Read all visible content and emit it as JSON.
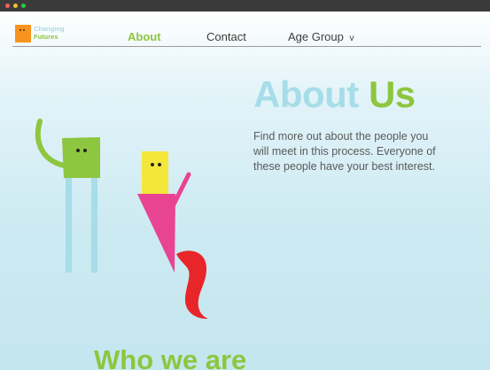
{
  "logo": {
    "line1": "Changing",
    "line2": "Futures"
  },
  "nav": {
    "about": "About",
    "contact": "Contact",
    "age_group": "Age Group",
    "age_group_chevron": "v"
  },
  "hero": {
    "title_word1": "About",
    "title_word2": "Us",
    "intro": "Find more out about the people you will meet in this process. Everyone of these people have your best interest."
  },
  "section": {
    "title": "Who we are"
  },
  "colors": {
    "green": "#8dc63f",
    "light_blue": "#a6dde8",
    "orange": "#f7931e",
    "pink": "#e94393",
    "yellow": "#f4e73a",
    "red": "#e8262a"
  },
  "window_controls": {
    "close_color": "#ff5f57",
    "minimize_color": "#febc2e",
    "maximize_color": "#28c840"
  }
}
